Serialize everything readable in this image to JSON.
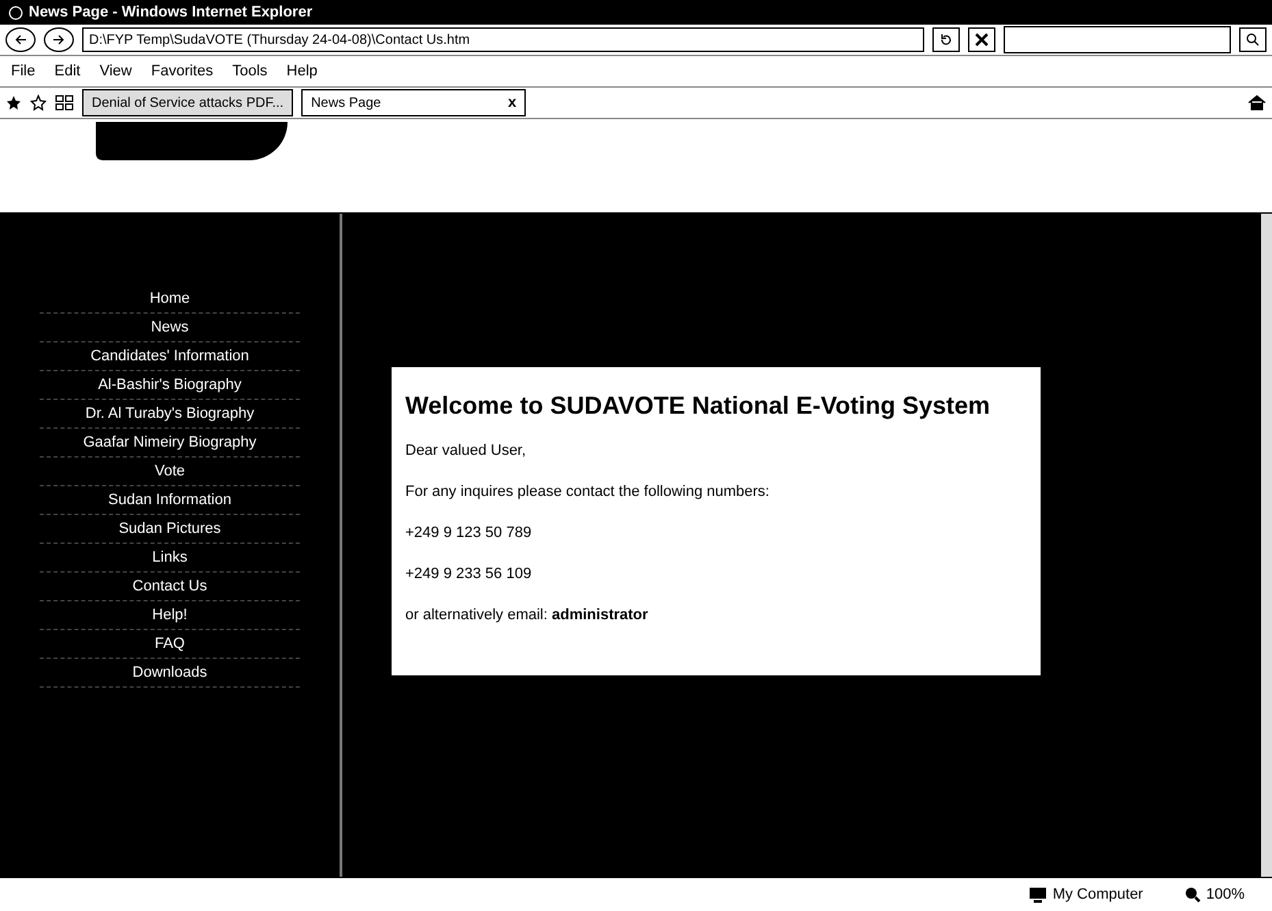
{
  "window": {
    "title": "News Page - Windows Internet Explorer"
  },
  "address_bar": {
    "value": "D:\\FYP Temp\\SudaVOTE (Thursday 24-04-08)\\Contact Us.htm"
  },
  "menu_bar": [
    "File",
    "Edit",
    "View",
    "Favorites",
    "Tools",
    "Help"
  ],
  "tabs": [
    {
      "label": "Denial of Service attacks PDF...",
      "selected": false
    },
    {
      "label": "News Page",
      "selected": true
    }
  ],
  "tab_close": "x",
  "sidebar": {
    "items": [
      "Home",
      "News",
      "Candidates' Information",
      "Al-Bashir's Biography",
      "Dr. Al Turaby's Biography",
      "Gaafar Nimeiry Biography",
      "Vote",
      "Sudan Information",
      "Sudan Pictures",
      "Links",
      "Contact Us",
      "Help!",
      "FAQ",
      "Downloads"
    ]
  },
  "content": {
    "heading": "Welcome to SUDAVOTE National E-Voting System",
    "paragraphs": [
      "Dear valued User,",
      "For any inquires please contact the following numbers:",
      "+249 9 123 50 789",
      "+249 9 233 56 109",
      "or alternatively email: **administrator**"
    ]
  },
  "status_bar": {
    "zone": "My Computer",
    "zoom": "100%"
  }
}
